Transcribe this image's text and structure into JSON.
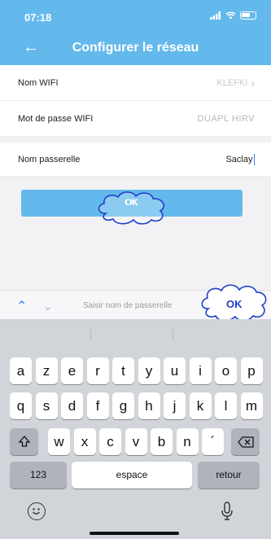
{
  "status": {
    "time": "07:18"
  },
  "header": {
    "title": "Configurer le réseau"
  },
  "form": {
    "wifi_name": {
      "label": "Nom WIFI",
      "value": "KLEFKI"
    },
    "wifi_password": {
      "label": "Mot de passe WIFI",
      "value": "DUAPL HIRV"
    },
    "gateway_name": {
      "label": "Nom passerelle",
      "value": "Saclay"
    }
  },
  "ok_button": {
    "label": "OK"
  },
  "annotations": {
    "cloud1": "OK",
    "cloud2": "OK"
  },
  "toolbar": {
    "hint": "Saisir nom de passerelle"
  },
  "keyboard": {
    "row1": [
      "a",
      "z",
      "e",
      "r",
      "t",
      "y",
      "u",
      "i",
      "o",
      "p"
    ],
    "row2": [
      "q",
      "s",
      "d",
      "f",
      "g",
      "h",
      "j",
      "k",
      "l",
      "m"
    ],
    "row3": [
      "w",
      "x",
      "c",
      "v",
      "b",
      "n",
      "´"
    ],
    "numbers": "123",
    "space": "espace",
    "return": "retour"
  },
  "colors": {
    "accent": "#64b9ec",
    "annotation": "#1e40c8"
  }
}
